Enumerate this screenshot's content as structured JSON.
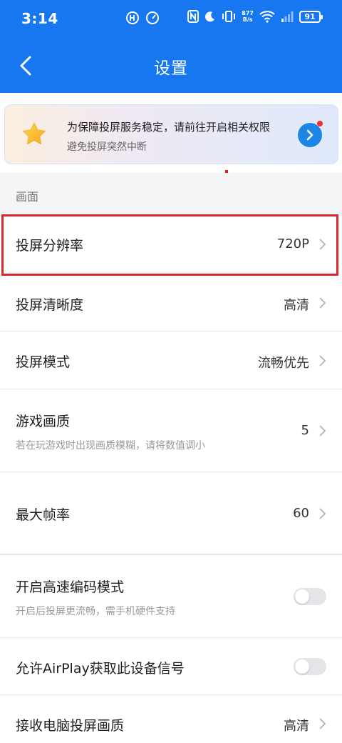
{
  "status_bar": {
    "time": "3:14",
    "net_speed_value": "877",
    "net_speed_unit": "B/s",
    "battery": "91"
  },
  "nav": {
    "title": "设置"
  },
  "notice": {
    "title": "为保障投屏服务稳定，请前往开启相关权限",
    "subtitle": "避免投屏突然中断"
  },
  "section": {
    "label": "画面"
  },
  "settings": {
    "resolution": {
      "label": "投屏分辨率",
      "value": "720P"
    },
    "clarity": {
      "label": "投屏清晰度",
      "value": "高清"
    },
    "mode": {
      "label": "投屏模式",
      "value": "流畅优先"
    },
    "game_quality": {
      "label": "游戏画质",
      "subtitle": "若在玩游戏时出现画质模糊，请将数值调小",
      "value": "5"
    },
    "max_fps": {
      "label": "最大帧率",
      "value": "60"
    },
    "high_speed_encoding": {
      "label": "开启高速编码模式",
      "subtitle": "开启后投屏更流畅，需手机硬件支持",
      "enabled": false
    },
    "airplay_signal": {
      "label": "允许AirPlay获取此设备信号",
      "enabled": false
    },
    "pc_quality": {
      "label": "接收电脑投屏画质",
      "value": "高清"
    }
  },
  "colors": {
    "brand": "#1677f0",
    "highlight_border": "#d9272e",
    "notice_dot": "#f0302d"
  },
  "icons": {
    "back": "chevron-left-icon",
    "chevron": "chevron-right-icon",
    "star": "star-icon",
    "notice_arrow": "arrow-right-circle-icon"
  }
}
